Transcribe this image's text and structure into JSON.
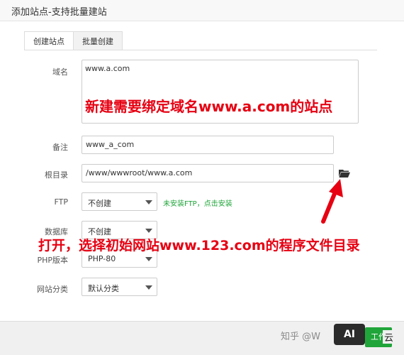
{
  "window": {
    "title": "添加站点-支持批量建站"
  },
  "tabs": [
    {
      "label": "创建站点",
      "active": true
    },
    {
      "label": "批量创建",
      "active": false
    }
  ],
  "form": {
    "domain": {
      "label": "域名",
      "value": "www.a.com"
    },
    "remark": {
      "label": "备注",
      "value": "www_a_com"
    },
    "root": {
      "label": "根目录",
      "value": "/www/wwwroot/www.a.com"
    },
    "ftp": {
      "label": "FTP",
      "selected": "不创建",
      "hint": "未安装FTP，点击安装"
    },
    "database": {
      "label": "数据库",
      "selected": "不创建"
    },
    "php": {
      "label": "PHP版本",
      "selected": "PHP-80"
    },
    "category": {
      "label": "网站分类",
      "selected": "默认分类"
    }
  },
  "annotations": {
    "top": "新建需要绑定域名www.a.com的站点",
    "bottom": "打开，选择初始网站www.123.com的程序文件目录"
  },
  "footer": {
    "watermark": "知乎 @W",
    "ai_badge": "AI",
    "button_label": "工作",
    "corner_text": "云"
  },
  "colors": {
    "accent_green": "#20a53a",
    "annotation_red": "#e60012"
  },
  "icons": {
    "folder": "folder-open-icon"
  }
}
